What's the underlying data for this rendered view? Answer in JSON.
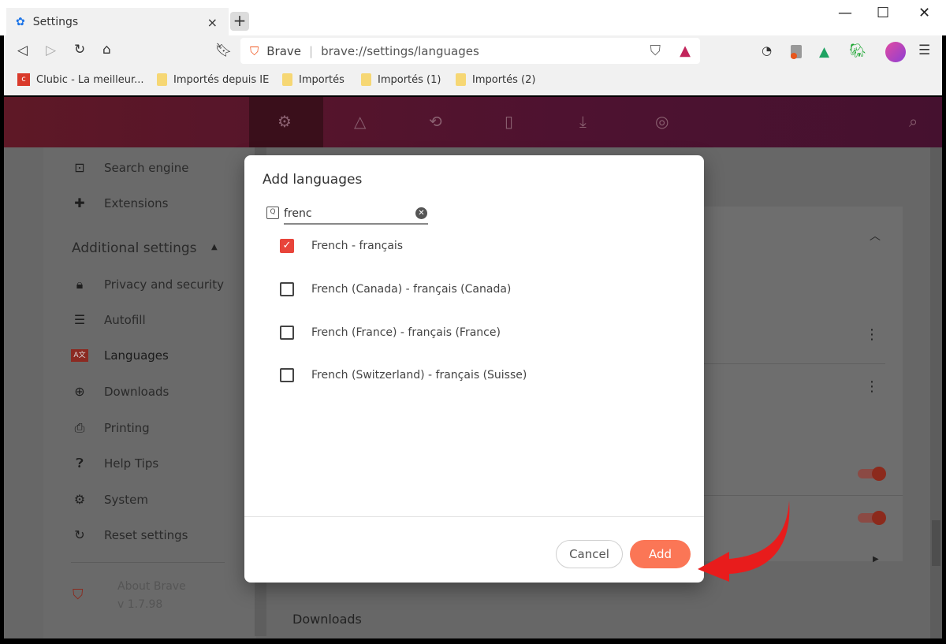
{
  "tab": {
    "title": "Settings",
    "close": "×",
    "new_tab": "+"
  },
  "window": {
    "minimize": "—",
    "maximize": "☐",
    "close": "✕"
  },
  "omnibox": {
    "brand": "Brave",
    "url": "brave://settings/languages"
  },
  "bookmarks": [
    "Clubic - La meilleur...",
    "Importés depuis IE",
    "Importés",
    "Importés (1)",
    "Importés (2)"
  ],
  "sidebar": {
    "items_top": [
      {
        "label": "Search engine",
        "icon": "search-engine-icon"
      },
      {
        "label": "Extensions",
        "icon": "puzzle-icon"
      }
    ],
    "additional_header": "Additional settings",
    "items": [
      {
        "label": "Privacy and security",
        "icon": "lock-icon"
      },
      {
        "label": "Autofill",
        "icon": "list-icon"
      },
      {
        "label": "Languages",
        "icon": "language-icon"
      },
      {
        "label": "Downloads",
        "icon": "download-icon"
      },
      {
        "label": "Printing",
        "icon": "printer-icon"
      },
      {
        "label": "Help Tips",
        "icon": "help-icon"
      },
      {
        "label": "System",
        "icon": "gear-icon"
      },
      {
        "label": "Reset settings",
        "icon": "reset-icon"
      }
    ],
    "about": "About Brave",
    "version": "v 1.7.98"
  },
  "main": {
    "section_downloads": "Downloads"
  },
  "dialog": {
    "title": "Add languages",
    "search_value": "frenc",
    "languages": [
      {
        "label": "French - français",
        "checked": true
      },
      {
        "label": "French (Canada) - français (Canada)",
        "checked": false
      },
      {
        "label": "French (France) - français (France)",
        "checked": false
      },
      {
        "label": "French (Switzerland) - français (Suisse)",
        "checked": false
      }
    ],
    "cancel": "Cancel",
    "add": "Add"
  },
  "colors": {
    "accent": "#fb7656",
    "checkbox": "#e8443a",
    "annotation_arrow": "#e81c1c"
  }
}
